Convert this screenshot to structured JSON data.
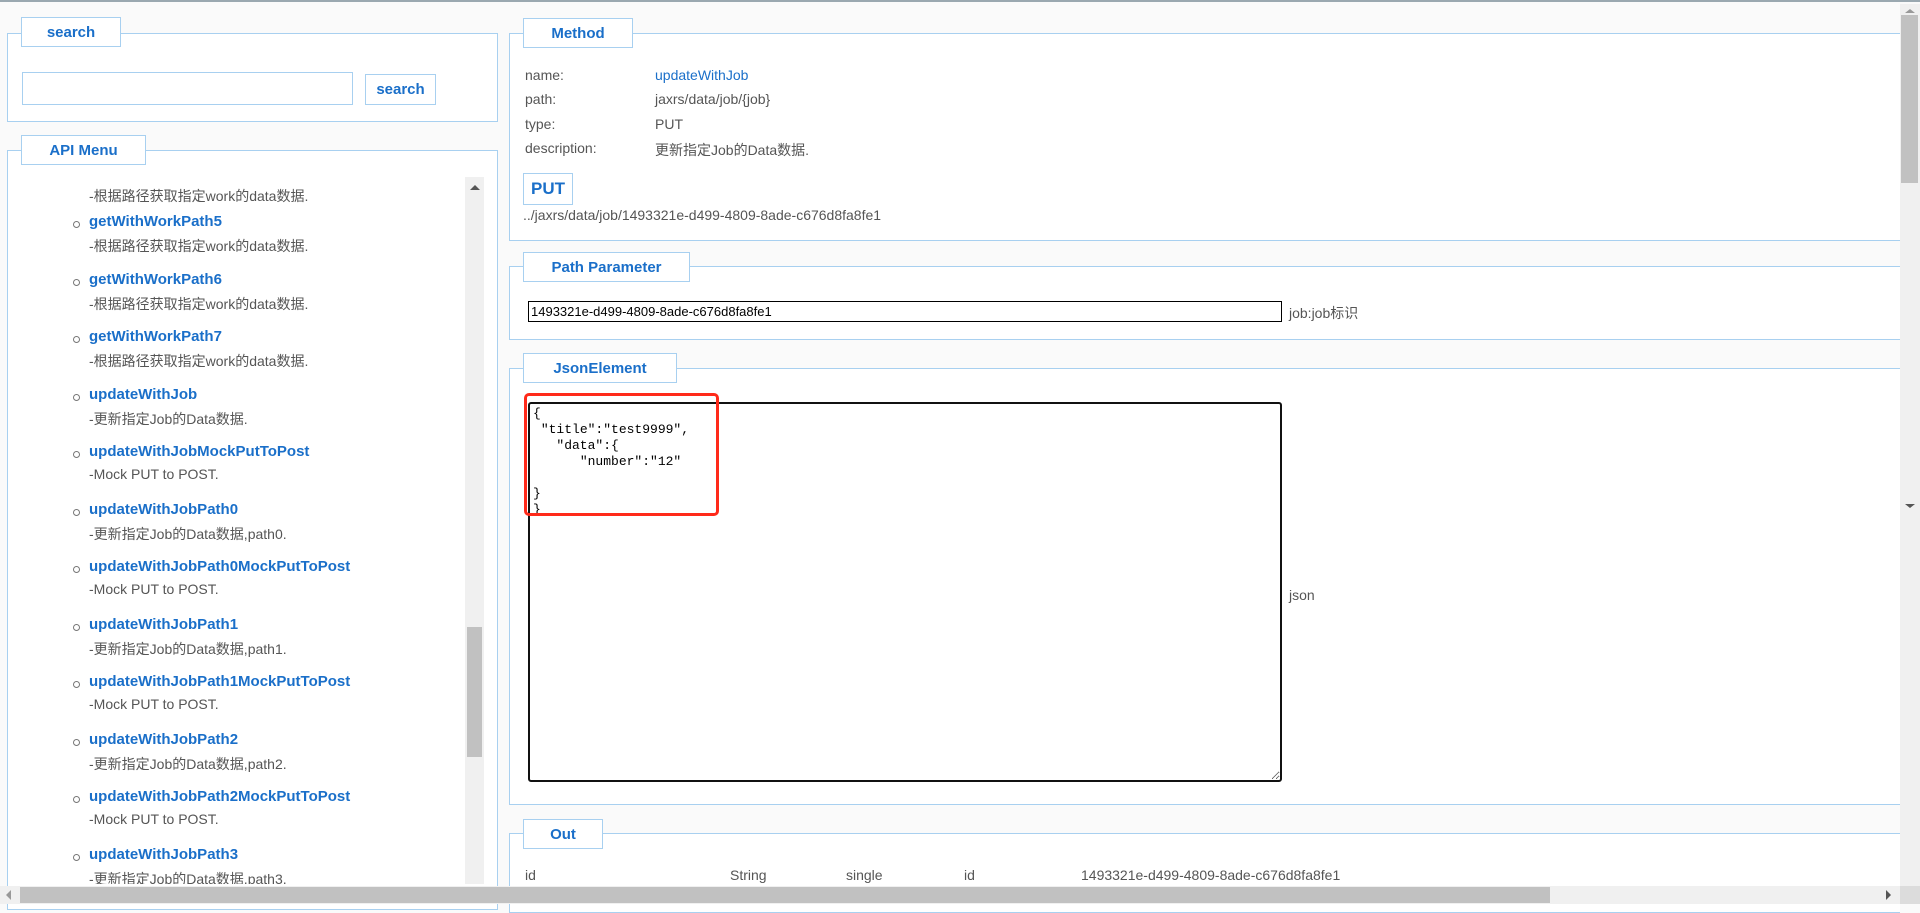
{
  "search": {
    "legend": "search",
    "input_value": "",
    "button_label": "search"
  },
  "menu": {
    "legend": "API Menu",
    "partial_desc": "-根据路径获取指定work的data数据.",
    "items": [
      {
        "title": "getWithWorkPath5",
        "desc": "-根据路径获取指定work的data数据."
      },
      {
        "title": "getWithWorkPath6",
        "desc": "-根据路径获取指定work的data数据."
      },
      {
        "title": "getWithWorkPath7",
        "desc": "-根据路径获取指定work的data数据."
      },
      {
        "title": "updateWithJob",
        "desc": "-更新指定Job的Data数据."
      },
      {
        "title": "updateWithJobMockPutToPost",
        "desc": "-Mock PUT to POST."
      },
      {
        "title": "updateWithJobPath0",
        "desc": "-更新指定Job的Data数据,path0."
      },
      {
        "title": "updateWithJobPath0MockPutToPost",
        "desc": "-Mock PUT to POST."
      },
      {
        "title": "updateWithJobPath1",
        "desc": "-更新指定Job的Data数据,path1."
      },
      {
        "title": "updateWithJobPath1MockPutToPost",
        "desc": "-Mock PUT to POST."
      },
      {
        "title": "updateWithJobPath2",
        "desc": "-更新指定Job的Data数据,path2."
      },
      {
        "title": "updateWithJobPath2MockPutToPost",
        "desc": "-Mock PUT to POST."
      },
      {
        "title": "updateWithJobPath3",
        "desc": "-更新指定Job的Data数据,path3."
      }
    ]
  },
  "method": {
    "legend": "Method",
    "name_label": "name:",
    "name_value": "updateWithJob",
    "path_label": "path:",
    "path_value": "jaxrs/data/job/{job}",
    "type_label": "type:",
    "type_value": "PUT",
    "desc_label": "description:",
    "desc_value": "更新指定Job的Data数据.",
    "button_label": "PUT",
    "url": "../jaxrs/data/job/1493321e-d499-4809-8ade-c676d8fa8fe1"
  },
  "path_param": {
    "legend": "Path Parameter",
    "value": "1493321e-d499-4809-8ade-c676d8fa8fe1",
    "label": "job:job标识"
  },
  "json_element": {
    "legend": "JsonElement",
    "value": "{\n \"title\":\"test9999\",\n   \"data\":{\n      \"number\":\"12\"\n\n}\n}",
    "label": "json"
  },
  "out": {
    "legend": "Out",
    "row": {
      "name": "id",
      "type": "String",
      "mode": "single",
      "field": "id",
      "value": "1493321e-d499-4809-8ade-c676d8fa8fe1"
    }
  },
  "colors": {
    "accent": "#1a6fc9",
    "border": "#a8d0f0",
    "highlight": "#ff2a1a"
  }
}
